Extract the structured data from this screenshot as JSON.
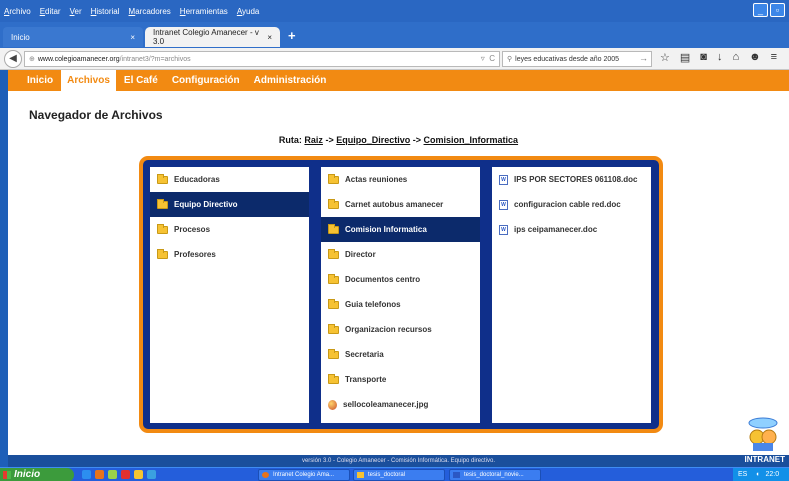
{
  "menubar": {
    "items": [
      "Archivo",
      "Editar",
      "Ver",
      "Historial",
      "Marcadores",
      "Herramientas",
      "Ayuda"
    ]
  },
  "tabs": [
    {
      "label": "Inicio",
      "close": "×"
    },
    {
      "label": "Intranet Colegio Amanecer - v 3.0",
      "close": "×"
    }
  ],
  "newtab": "+",
  "address": {
    "host": "www.colegioamanecer.org",
    "path": "/intranet3/?m=archivos"
  },
  "search": {
    "value": "leyes educativas desde año 2005"
  },
  "site": {
    "nav": [
      "Inicio",
      "Archivos",
      "El Café",
      "Configuración",
      "Administración"
    ],
    "active_nav": "Archivos",
    "title": "Navegador de Archivos",
    "ruta": {
      "label": "Ruta:",
      "sep": "->",
      "crumbs": [
        "Raiz",
        "Equipo_Directivo",
        "Comision_Informatica"
      ]
    },
    "columns": [
      {
        "items": [
          {
            "name": "Educadoras",
            "type": "folder"
          },
          {
            "name": "Equipo Directivo",
            "type": "folder",
            "selected": true
          },
          {
            "name": "Procesos",
            "type": "folder"
          },
          {
            "name": "Profesores",
            "type": "folder"
          }
        ]
      },
      {
        "items": [
          {
            "name": "Actas reuniones",
            "type": "folder"
          },
          {
            "name": "Carnet autobus amanecer",
            "type": "folder"
          },
          {
            "name": "Comision Informatica",
            "type": "folder",
            "selected": true
          },
          {
            "name": "Director",
            "type": "folder"
          },
          {
            "name": "Documentos centro",
            "type": "folder"
          },
          {
            "name": "Guia telefonos",
            "type": "folder"
          },
          {
            "name": "Organizacion recursos",
            "type": "folder"
          },
          {
            "name": "Secretaria",
            "type": "folder"
          },
          {
            "name": "Transporte",
            "type": "folder"
          },
          {
            "name": "sellocoleamanecer.jpg",
            "type": "image"
          }
        ]
      },
      {
        "items": [
          {
            "name": "IPS POR SECTORES 061108.doc",
            "type": "doc"
          },
          {
            "name": "configuracion cable red.doc",
            "type": "doc"
          },
          {
            "name": "ips ceipamanecer.doc",
            "type": "doc"
          }
        ]
      }
    ],
    "footer": "versión 3.0 - Colegio Amanecer - Comisión Informática. Equipo directivo.",
    "brand": "INTRANET"
  },
  "taskbar": {
    "start": "Inicio",
    "buttons": [
      "Intranet Colegio Ama...",
      "tesis_doctoral",
      "tesis_doctoral_novie..."
    ],
    "tray": "ES",
    "clock": "22:0"
  },
  "colors": {
    "accent": "#f28a12",
    "panel": "#0f2f8a",
    "selected": "#0c2a6b"
  }
}
